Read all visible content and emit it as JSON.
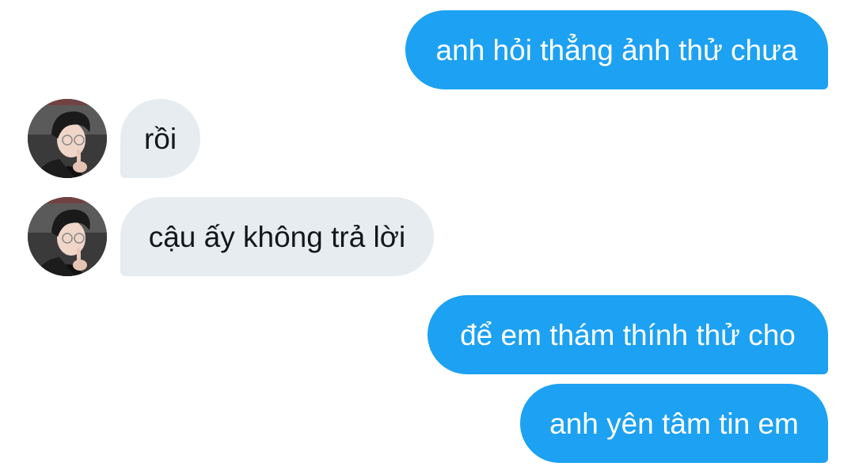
{
  "conversation": {
    "messages": [
      {
        "direction": "sent",
        "text": "anh hỏi thẳng ảnh thử chưa"
      },
      {
        "direction": "received",
        "text": "rồi"
      },
      {
        "direction": "received",
        "text": "cậu ấy không trả lời"
      },
      {
        "direction": "sent",
        "text": "để em thám thính thử cho"
      },
      {
        "direction": "sent",
        "text": "anh yên tâm tin em"
      }
    ],
    "colors": {
      "sent_bubble": "#1da1f2",
      "sent_text": "#ffffff",
      "received_bubble": "#e6ecf0",
      "received_text": "#14171a",
      "background": "#ffffff"
    },
    "avatar_icon": "user-avatar-photo"
  }
}
